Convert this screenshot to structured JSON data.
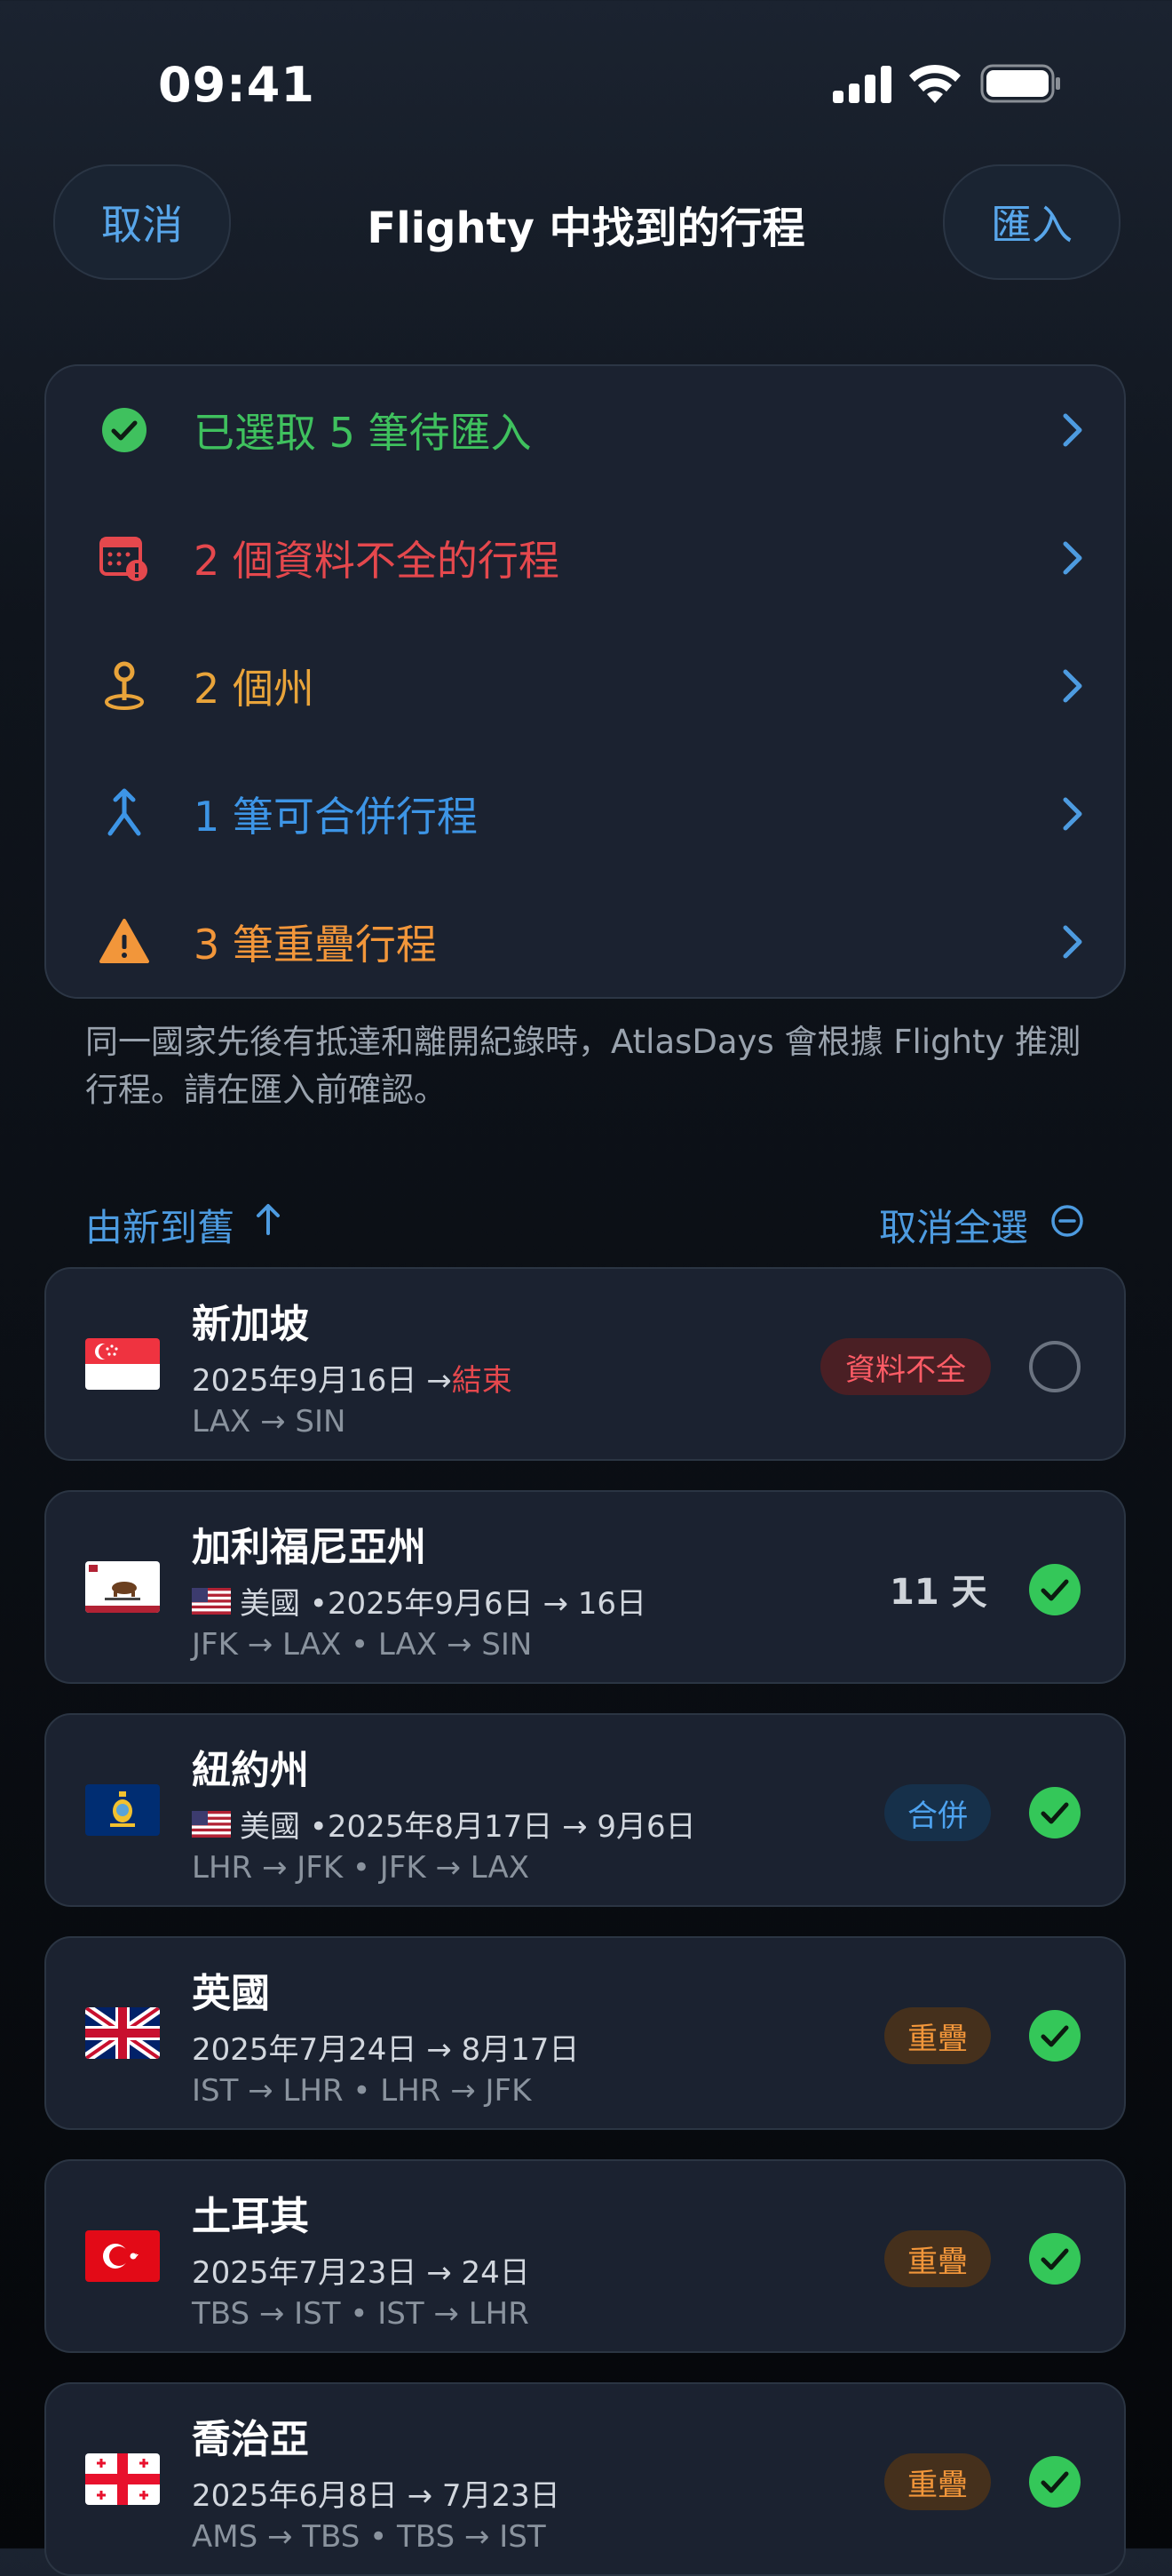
{
  "status_bar": {
    "time": "09:41"
  },
  "nav": {
    "cancel": "取消",
    "title": "Flighty 中找到的行程",
    "import": "匯入"
  },
  "summary": [
    {
      "icon": "check-circle-icon",
      "label": "已選取 5 筆待匯入",
      "color": "#3fc15e"
    },
    {
      "icon": "calendar-alert-icon",
      "label": "2 個資料不全的行程",
      "color": "#e5484d"
    },
    {
      "icon": "location-pin-icon",
      "label": "2 個州",
      "color": "#e9a43a"
    },
    {
      "icon": "merge-icon",
      "label": "1 筆可合併行程",
      "color": "#3d95e6"
    },
    {
      "icon": "warning-icon",
      "label": "3 筆重疊行程",
      "color": "#f2963a"
    }
  ],
  "note": "同一國家先後有抵達和離開紀錄時，AtlasDays 會根據 Flighty 推測行程。請在匯入前確認。",
  "list_header": {
    "sort": "由新到舊",
    "deselect": "取消全選"
  },
  "trips": [
    {
      "flag": "singapore-flag",
      "title": "新加坡",
      "sub_prefix": "",
      "sub": "2025年9月16日 → ",
      "sub_end": "結束",
      "route": "LAX → SIN",
      "badge": "資料不全",
      "badge_type": "red",
      "days": "",
      "selected": false
    },
    {
      "flag": "california-flag",
      "title": "加利福尼亞州",
      "sub_prefix": "美國 • ",
      "sub": "2025年9月6日 → 16日",
      "sub_end": "",
      "route": "JFK → LAX • LAX → SIN",
      "badge": "",
      "badge_type": "",
      "days": "11 天",
      "selected": true
    },
    {
      "flag": "new-york-flag",
      "title": "紐約州",
      "sub_prefix": "美國 • ",
      "sub": "2025年8月17日 → 9月6日",
      "sub_end": "",
      "route": "LHR → JFK • JFK → LAX",
      "badge": "合併",
      "badge_type": "blue",
      "days": "",
      "selected": true
    },
    {
      "flag": "uk-flag",
      "title": "英國",
      "sub_prefix": "",
      "sub": "2025年7月24日 → 8月17日",
      "sub_end": "",
      "route": "IST → LHR • LHR → JFK",
      "badge": "重疊",
      "badge_type": "orange",
      "days": "",
      "selected": true
    },
    {
      "flag": "turkey-flag",
      "title": "土耳其",
      "sub_prefix": "",
      "sub": "2025年7月23日 → 24日",
      "sub_end": "",
      "route": "TBS → IST • IST → LHR",
      "badge": "重疊",
      "badge_type": "orange",
      "days": "",
      "selected": true
    },
    {
      "flag": "georgia-flag",
      "title": "喬治亞",
      "sub_prefix": "",
      "sub": "2025年6月8日 → 7月23日",
      "sub_end": "",
      "route": "AMS → TBS • TBS → IST",
      "badge": "重疊",
      "badge_type": "orange",
      "days": "",
      "selected": true
    }
  ]
}
